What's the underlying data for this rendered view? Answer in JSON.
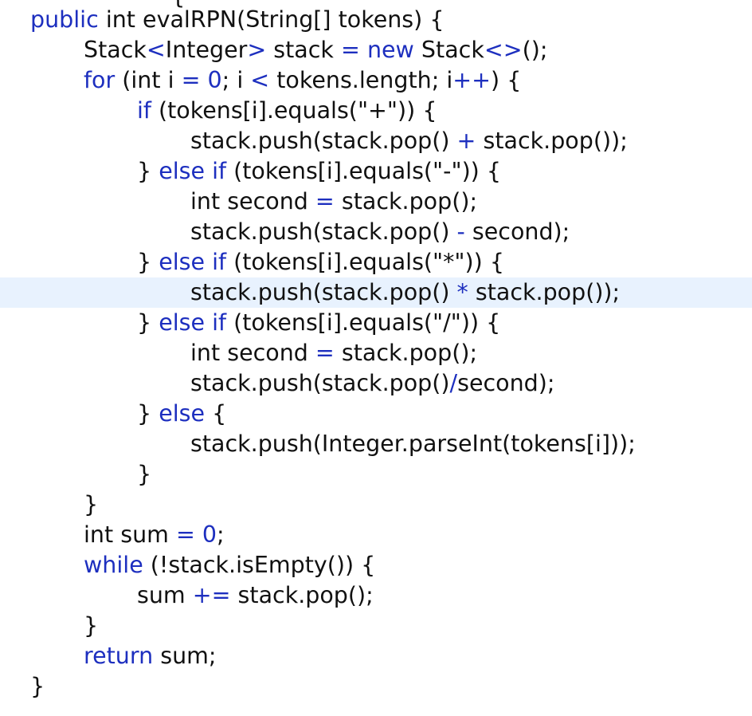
{
  "editor": {
    "colors": {
      "background": "#ffffff",
      "text": "#111111",
      "keyword": "#1d2fbf",
      "current_line_highlight": "#e8f2fe"
    },
    "top_fragment": "{",
    "current_line_index": 9,
    "lines": [
      {
        "indent": 0,
        "tokens": [
          {
            "t": "kw",
            "v": "public"
          },
          {
            "t": "plain",
            "v": " int evalRPN(String[] tokens) {"
          }
        ]
      },
      {
        "indent": 1,
        "tokens": [
          {
            "t": "plain",
            "v": "Stack"
          },
          {
            "t": "op",
            "v": "<"
          },
          {
            "t": "plain",
            "v": "Integer"
          },
          {
            "t": "op",
            "v": ">"
          },
          {
            "t": "plain",
            "v": " stack "
          },
          {
            "t": "op",
            "v": "="
          },
          {
            "t": "plain",
            "v": " "
          },
          {
            "t": "kw",
            "v": "new"
          },
          {
            "t": "plain",
            "v": " Stack"
          },
          {
            "t": "op",
            "v": "<>"
          },
          {
            "t": "plain",
            "v": "();"
          }
        ]
      },
      {
        "indent": 1,
        "tokens": [
          {
            "t": "kw",
            "v": "for"
          },
          {
            "t": "plain",
            "v": " (int i "
          },
          {
            "t": "op",
            "v": "="
          },
          {
            "t": "plain",
            "v": " "
          },
          {
            "t": "num",
            "v": "0"
          },
          {
            "t": "plain",
            "v": "; i "
          },
          {
            "t": "op",
            "v": "<"
          },
          {
            "t": "plain",
            "v": " tokens.length; i"
          },
          {
            "t": "op",
            "v": "++"
          },
          {
            "t": "plain",
            "v": ") {"
          }
        ]
      },
      {
        "indent": 2,
        "tokens": [
          {
            "t": "kw",
            "v": "if"
          },
          {
            "t": "plain",
            "v": " (tokens[i].equals("
          },
          {
            "t": "str",
            "v": "\"+\""
          },
          {
            "t": "plain",
            "v": ")) {"
          }
        ]
      },
      {
        "indent": 3,
        "tokens": [
          {
            "t": "plain",
            "v": "stack.push(stack.pop() "
          },
          {
            "t": "op",
            "v": "+"
          },
          {
            "t": "plain",
            "v": " stack.pop());"
          }
        ]
      },
      {
        "indent": 2,
        "tokens": [
          {
            "t": "plain",
            "v": "} "
          },
          {
            "t": "kw",
            "v": "else"
          },
          {
            "t": "plain",
            "v": " "
          },
          {
            "t": "kw",
            "v": "if"
          },
          {
            "t": "plain",
            "v": " (tokens[i].equals("
          },
          {
            "t": "str",
            "v": "\"-\""
          },
          {
            "t": "plain",
            "v": ")) {"
          }
        ]
      },
      {
        "indent": 3,
        "tokens": [
          {
            "t": "plain",
            "v": "int second "
          },
          {
            "t": "op",
            "v": "="
          },
          {
            "t": "plain",
            "v": " stack.pop();"
          }
        ]
      },
      {
        "indent": 3,
        "tokens": [
          {
            "t": "plain",
            "v": "stack.push(stack.pop() "
          },
          {
            "t": "op",
            "v": "-"
          },
          {
            "t": "plain",
            "v": " second);"
          }
        ]
      },
      {
        "indent": 2,
        "tokens": [
          {
            "t": "plain",
            "v": "} "
          },
          {
            "t": "kw",
            "v": "else"
          },
          {
            "t": "plain",
            "v": " "
          },
          {
            "t": "kw",
            "v": "if"
          },
          {
            "t": "plain",
            "v": " (tokens[i].equals("
          },
          {
            "t": "str",
            "v": "\"*\""
          },
          {
            "t": "plain",
            "v": ")) {"
          }
        ]
      },
      {
        "indent": 3,
        "tokens": [
          {
            "t": "plain",
            "v": "stack.push(stack.pop() "
          },
          {
            "t": "op",
            "v": "*"
          },
          {
            "t": "plain",
            "v": " stack.pop());"
          }
        ]
      },
      {
        "indent": 2,
        "tokens": [
          {
            "t": "plain",
            "v": "} "
          },
          {
            "t": "kw",
            "v": "else"
          },
          {
            "t": "plain",
            "v": " "
          },
          {
            "t": "kw",
            "v": "if"
          },
          {
            "t": "plain",
            "v": " (tokens[i].equals("
          },
          {
            "t": "str",
            "v": "\"/\""
          },
          {
            "t": "plain",
            "v": ")) {"
          }
        ]
      },
      {
        "indent": 3,
        "tokens": [
          {
            "t": "plain",
            "v": "int second "
          },
          {
            "t": "op",
            "v": "="
          },
          {
            "t": "plain",
            "v": " stack.pop();"
          }
        ]
      },
      {
        "indent": 3,
        "tokens": [
          {
            "t": "plain",
            "v": "stack.push(stack.pop()"
          },
          {
            "t": "op",
            "v": "/"
          },
          {
            "t": "plain",
            "v": "second);"
          }
        ]
      },
      {
        "indent": 2,
        "tokens": [
          {
            "t": "plain",
            "v": "} "
          },
          {
            "t": "kw",
            "v": "else"
          },
          {
            "t": "plain",
            "v": " {"
          }
        ]
      },
      {
        "indent": 3,
        "tokens": [
          {
            "t": "plain",
            "v": "stack.push(Integer.parseInt(tokens[i]));"
          }
        ]
      },
      {
        "indent": 2,
        "tokens": [
          {
            "t": "plain",
            "v": "}"
          }
        ]
      },
      {
        "indent": 1,
        "tokens": [
          {
            "t": "plain",
            "v": "}"
          }
        ]
      },
      {
        "indent": 1,
        "tokens": [
          {
            "t": "plain",
            "v": "int sum "
          },
          {
            "t": "op",
            "v": "="
          },
          {
            "t": "plain",
            "v": " "
          },
          {
            "t": "num",
            "v": "0"
          },
          {
            "t": "plain",
            "v": ";"
          }
        ]
      },
      {
        "indent": 1,
        "tokens": [
          {
            "t": "kw",
            "v": "while"
          },
          {
            "t": "plain",
            "v": " (!stack.isEmpty()) {"
          }
        ]
      },
      {
        "indent": 2,
        "tokens": [
          {
            "t": "plain",
            "v": "sum "
          },
          {
            "t": "op",
            "v": "+="
          },
          {
            "t": "plain",
            "v": " stack.pop();"
          }
        ]
      },
      {
        "indent": 1,
        "tokens": [
          {
            "t": "plain",
            "v": "}"
          }
        ]
      },
      {
        "indent": 1,
        "tokens": [
          {
            "t": "kw",
            "v": "return"
          },
          {
            "t": "plain",
            "v": " sum;"
          }
        ]
      },
      {
        "indent": 0,
        "tokens": [
          {
            "t": "plain",
            "v": "}"
          }
        ]
      }
    ]
  }
}
